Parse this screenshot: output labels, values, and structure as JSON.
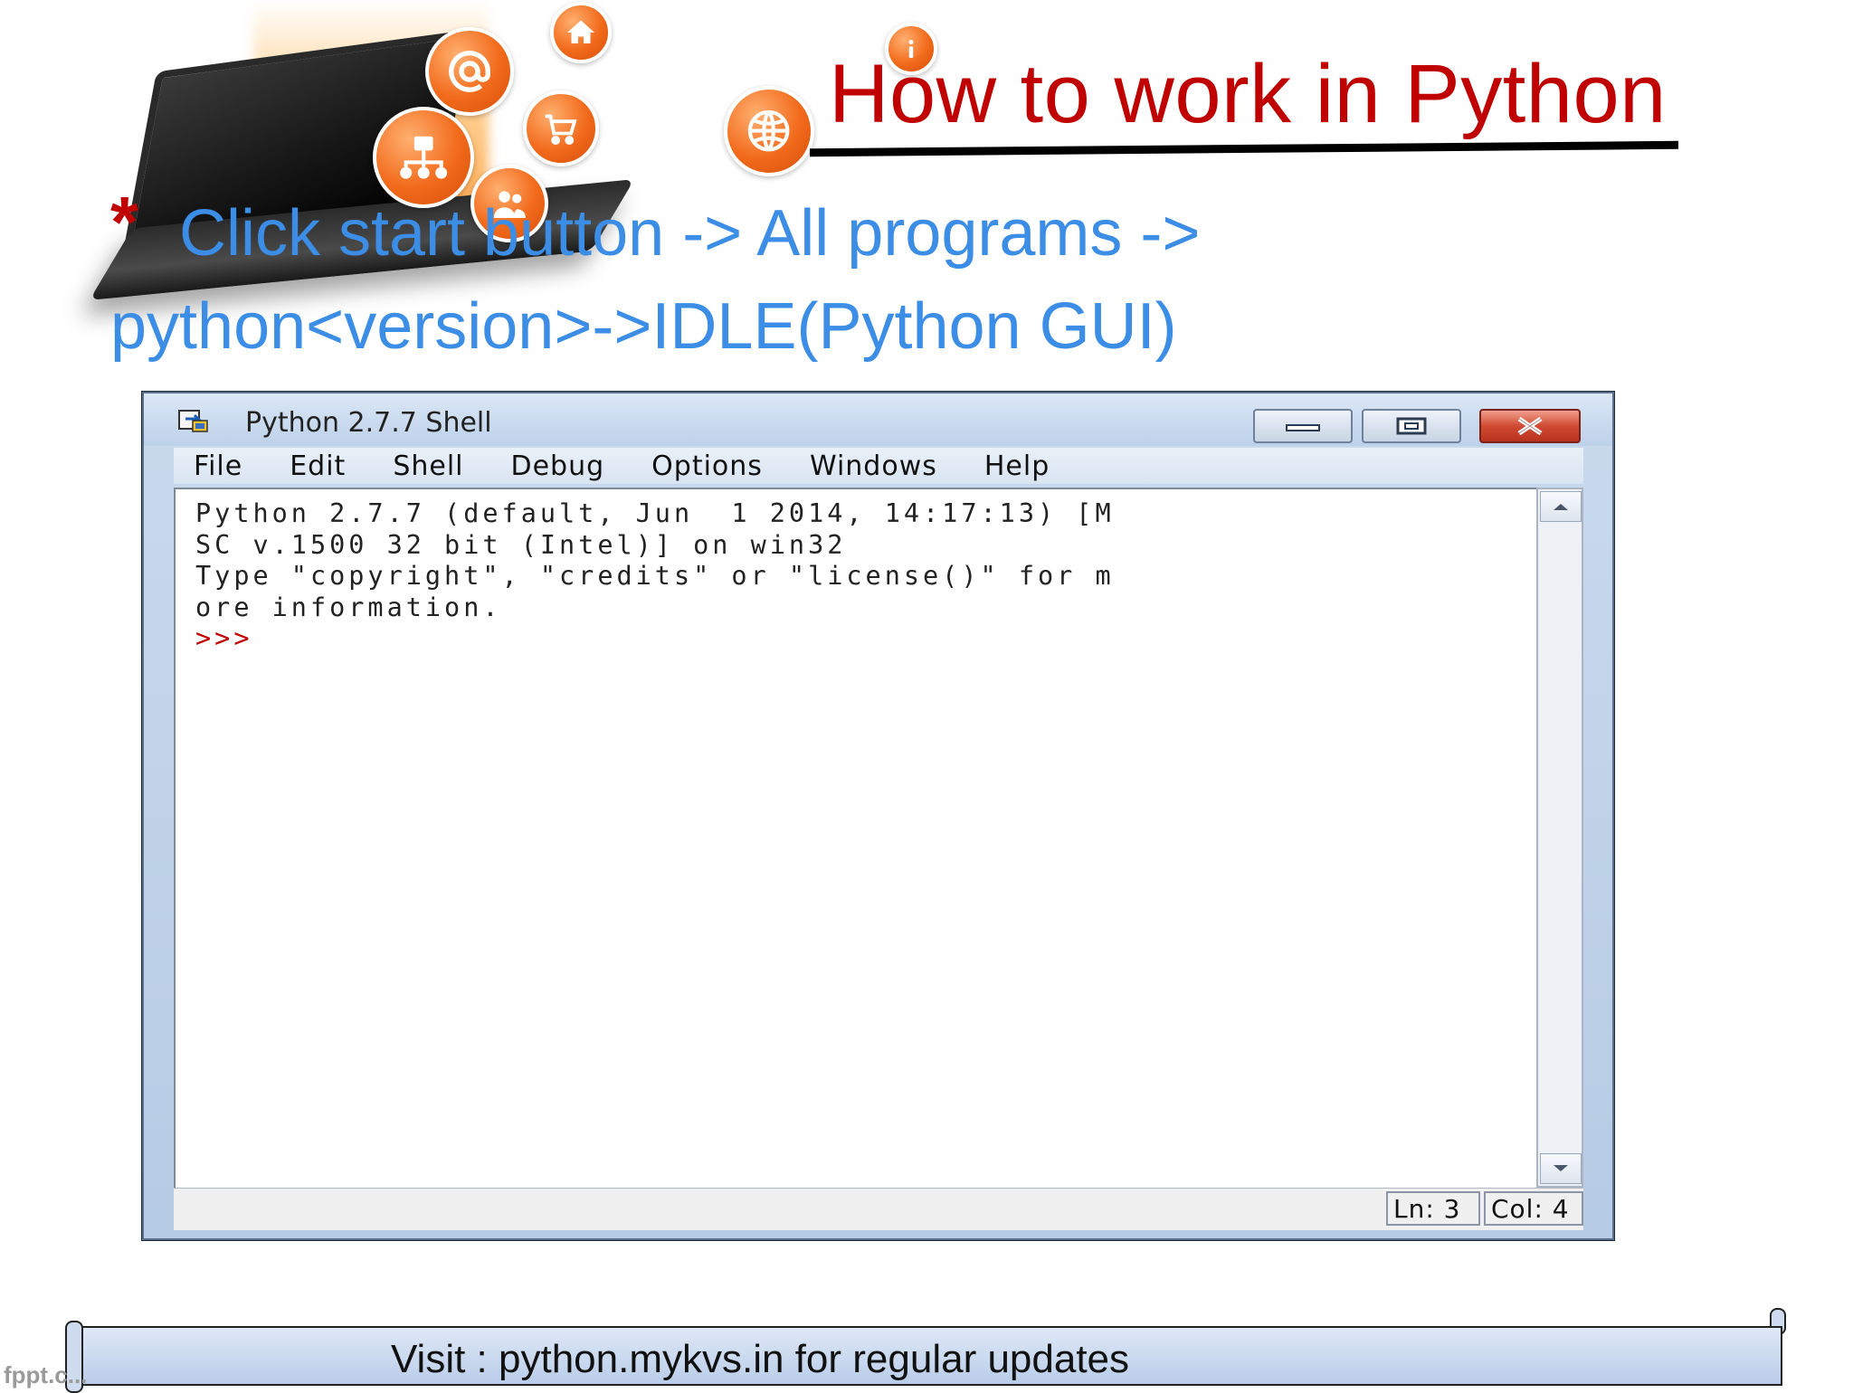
{
  "slide": {
    "title": "How to work in Python",
    "bullet_marker": "*",
    "instruction_line1": "Click start button -> All programs  ->",
    "instruction_line2": "python<version>->IDLE(Python GUI)",
    "footer": "Visit : python.mykvs.in for regular updates",
    "watermark": "fppt.c...",
    "title_color": "#c00000",
    "instruction_color": "#3b8de6"
  },
  "window": {
    "title": "Python 2.7.7 Shell",
    "menu": [
      "File",
      "Edit",
      "Shell",
      "Debug",
      "Options",
      "Windows",
      "Help"
    ],
    "shell_output": "Python 2.7.7 (default, Jun  1 2014, 14:17:13) [M\nSC v.1500 32 bit (Intel)] on win32\nType \"copyright\", \"credits\" or \"license()\" for m\nore information.",
    "prompt": ">>>",
    "status": {
      "ln": "Ln: 3",
      "col": "Col: 4"
    }
  },
  "icons": {
    "app": "python-idle-icon",
    "decorations": [
      "email-icon",
      "home-icon",
      "shopping-cart-icon",
      "network-icon",
      "users-icon",
      "globe-icon",
      "info-icon"
    ]
  }
}
